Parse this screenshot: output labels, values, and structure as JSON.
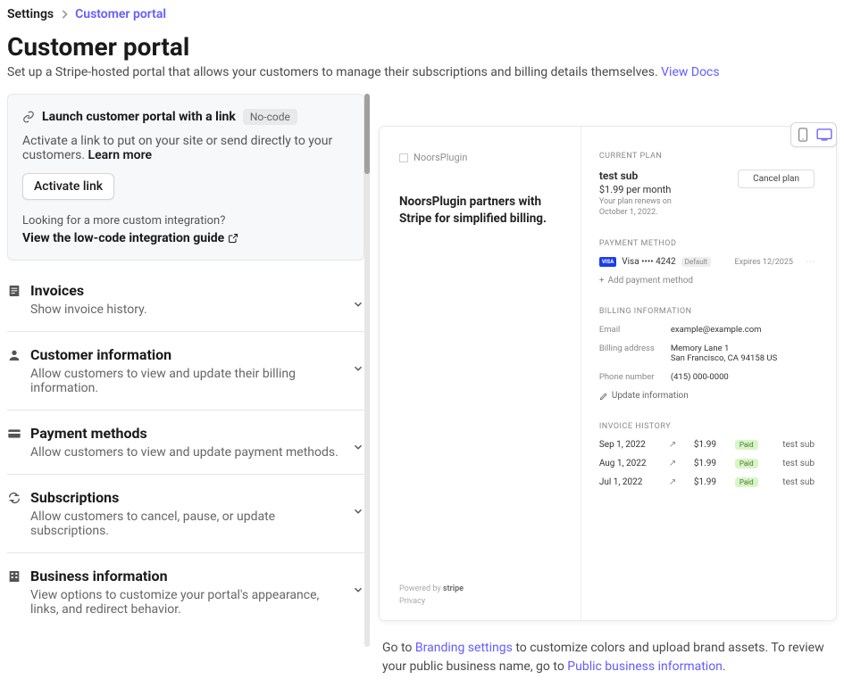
{
  "breadcrumb": {
    "root": "Settings",
    "current": "Customer portal"
  },
  "header": {
    "title": "Customer portal",
    "subtitle": "Set up a Stripe-hosted portal that allows your customers to manage their subscriptions and billing details themselves.",
    "docs_link": "View Docs"
  },
  "launch": {
    "title": "Launch customer portal with a link",
    "badge": "No-code",
    "desc": "Activate a link to put on your site or send directly to your customers.",
    "learn_more": "Learn more",
    "button": "Activate link",
    "looking": "Looking for a more custom integration?",
    "low_code": "View the low-code integration guide"
  },
  "sections": [
    {
      "icon": "invoice-icon",
      "title": "Invoices",
      "desc": "Show invoice history."
    },
    {
      "icon": "user-icon",
      "title": "Customer information",
      "desc": "Allow customers to view and update their billing information."
    },
    {
      "icon": "card-icon",
      "title": "Payment methods",
      "desc": "Allow customers to view and update payment methods."
    },
    {
      "icon": "refresh-icon",
      "title": "Subscriptions",
      "desc": "Allow customers to cancel, pause, or update subscriptions."
    },
    {
      "icon": "building-icon",
      "title": "Business information",
      "desc": "View options to customize your portal's appearance, links, and redirect behavior."
    }
  ],
  "preview": {
    "brand": "NoorsPlugin",
    "tagline": "NoorsPlugin partners with Stripe for simplified billing.",
    "footer_powered": "Powered by",
    "footer_stripe": "stripe",
    "footer_privacy": "Privacy",
    "plan": {
      "hdr": "CURRENT PLAN",
      "name": "test sub",
      "price": "$1.99 per month",
      "renew1": "Your plan renews on",
      "renew2": "October 1, 2022.",
      "cancel": "Cancel plan"
    },
    "pm": {
      "hdr": "PAYMENT METHOD",
      "visa": "VISA",
      "card_text": "Visa •••• 4242",
      "default": "Default",
      "expires": "Expires 12/2025",
      "add": "Add payment method"
    },
    "billing": {
      "hdr": "BILLING INFORMATION",
      "rows": [
        {
          "label": "Email",
          "value": "example@example.com"
        },
        {
          "label": "Billing address",
          "value": "Memory Lane 1\nSan Francisco, CA 94158 US"
        },
        {
          "label": "Phone number",
          "value": "(415) 000-0000"
        }
      ],
      "update": "Update information"
    },
    "invoices": {
      "hdr": "INVOICE HISTORY",
      "rows": [
        {
          "date": "Sep 1, 2022",
          "amount": "$1.99",
          "status": "Paid",
          "name": "test sub"
        },
        {
          "date": "Aug 1, 2022",
          "amount": "$1.99",
          "status": "Paid",
          "name": "test sub"
        },
        {
          "date": "Jul 1, 2022",
          "amount": "$1.99",
          "status": "Paid",
          "name": "test sub"
        }
      ]
    }
  },
  "footer": {
    "pre1": "Go to ",
    "link1": "Branding settings",
    "mid": " to customize colors and upload brand assets. To review your public business name, go to ",
    "link2": "Public business information",
    "post": "."
  }
}
